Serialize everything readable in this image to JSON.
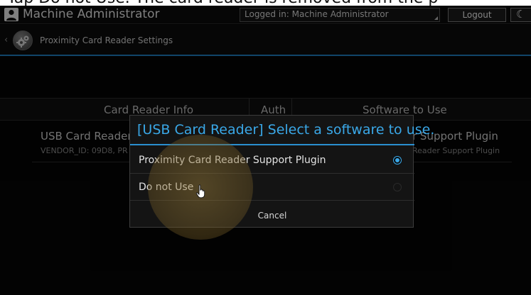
{
  "caption": "Tap Do not Use. The card reader is removed from the p",
  "topbar": {
    "user_icon": "user-icon",
    "user_name": "Machine Administrator",
    "login_status": "Logged in: Machine Administrator",
    "logout_label": "Logout",
    "night_icon": "moon-icon"
  },
  "titlebar": {
    "back_icon": "chevron-left-icon",
    "settings_icon": "gear-icon",
    "title": "Proximity Card Reader Settings"
  },
  "table": {
    "columns": [
      "Card Reader Info",
      "Auth",
      "Software to Use"
    ],
    "row": {
      "reader_name": "USB Card Reader",
      "vendor_id": "VENDOR_ID: 09D8, PR",
      "software": "r Support Plugin",
      "software_sub": "Reader Support Plugin"
    }
  },
  "dialog": {
    "title": "[USB Card Reader] Select a software to use.",
    "options": [
      {
        "label": "Proximity Card Reader Support Plugin",
        "selected": true
      },
      {
        "label": "Do not Use",
        "selected": false
      }
    ],
    "cancel_label": "Cancel"
  },
  "colors": {
    "accent": "#3aa8e8",
    "background": "#050505",
    "touch_highlight": "#a0823c"
  }
}
